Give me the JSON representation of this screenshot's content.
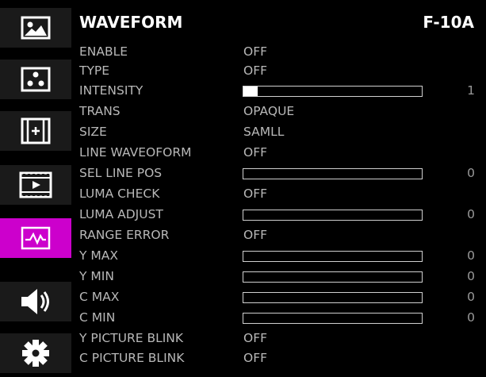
{
  "sidebar": {
    "tabs": [
      {
        "icon": "picture-icon",
        "active": false
      },
      {
        "icon": "color-dots-icon",
        "active": false
      },
      {
        "icon": "marker-icon",
        "active": false
      },
      {
        "icon": "film-icon",
        "active": false
      },
      {
        "icon": "waveform-icon",
        "active": true
      },
      {
        "icon": "speaker-icon",
        "active": false
      },
      {
        "icon": "gear-icon",
        "active": false
      }
    ]
  },
  "header": {
    "title": "WAVEFORM",
    "model": "F-10A"
  },
  "menu": {
    "rows": [
      {
        "label": "ENABLE",
        "value": "OFF"
      },
      {
        "label": "TYPE",
        "value": "OFF"
      },
      {
        "label": "INTENSITY",
        "number": "1",
        "level": 0.08
      },
      {
        "label": "TRANS",
        "value": "OPAQUE"
      },
      {
        "label": "SIZE",
        "value": "SAMLL"
      },
      {
        "label": "LINE WAVEOFORM",
        "value": "OFF"
      },
      {
        "label": "SEL LINE POS",
        "number": "0",
        "level": 0
      },
      {
        "label": "LUMA CHECK",
        "value": "OFF"
      },
      {
        "label": "LUMA ADJUST",
        "number": "0",
        "level": 0
      },
      {
        "label": "RANGE ERROR",
        "value": "OFF"
      },
      {
        "label": "Y MAX",
        "number": "0",
        "level": 0
      },
      {
        "label": "Y MIN",
        "number": "0",
        "level": 0
      },
      {
        "label": "C MAX",
        "number": "0",
        "level": 0
      },
      {
        "label": "C MIN",
        "number": "0",
        "level": 0
      },
      {
        "label": "Y PICTURE BLINK",
        "value": "OFF"
      },
      {
        "label": "C PICTURE BLINK",
        "value": "OFF"
      }
    ]
  },
  "colors": {
    "active_tab": "#cc00cc",
    "tab_bg": "#1a1a1a",
    "text": "#b8b8b8"
  }
}
